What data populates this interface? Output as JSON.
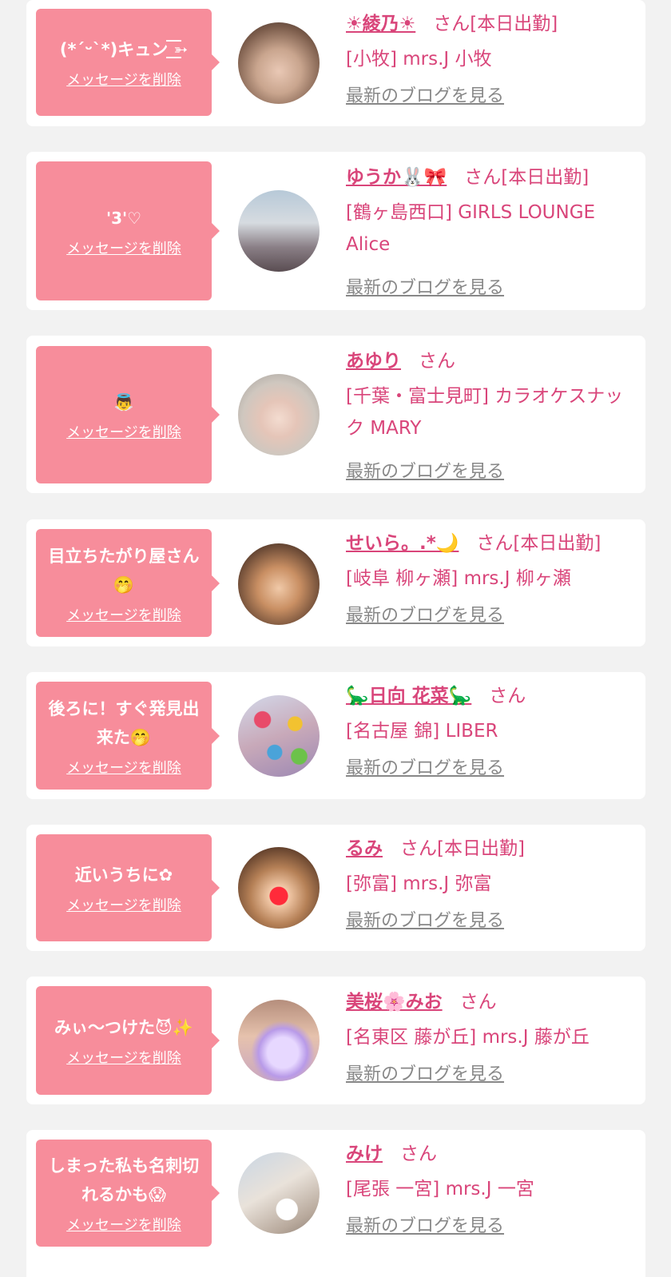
{
  "items": [
    {
      "message": "(*ˊᵕˋ*)キュン ͟͟͞͞➳",
      "delete_label": "メッセージを削除",
      "name": "☀綾乃☀",
      "san": "さん[本日出勤]",
      "shop": "[小牧] mrs.J 小牧",
      "blog_label": "最新のブログを見る"
    },
    {
      "message": "'3'♡",
      "delete_label": "メッセージを削除",
      "name": "ゆうか🐰🎀",
      "san": "さん[本日出勤]",
      "shop": "[鶴ヶ島西口] GIRLS LOUNGE Alice",
      "blog_label": "最新のブログを見る"
    },
    {
      "message": "👼",
      "delete_label": "メッセージを削除",
      "name": "あゆり",
      "san": "さん",
      "shop": "[千葉・富士見町] カラオケスナック MARY",
      "blog_label": "最新のブログを見る"
    },
    {
      "message": "目立ちたがり屋さん🤭",
      "delete_label": "メッセージを削除",
      "name": "せいら。.*🌙",
      "san": "さん[本日出勤]",
      "shop": "[岐阜 柳ヶ瀬] mrs.J 柳ヶ瀬",
      "blog_label": "最新のブログを見る"
    },
    {
      "message": "後ろに！すぐ発見出来た🤭",
      "delete_label": "メッセージを削除",
      "name": "🦕日向 花菜🦕",
      "san": "さん",
      "shop": "[名古屋 錦] LIBER",
      "blog_label": "最新のブログを見る"
    },
    {
      "message": "近いうちに✿",
      "delete_label": "メッセージを削除",
      "name": "るみ",
      "san": "さん[本日出勤]",
      "shop": "[弥富] mrs.J 弥富",
      "blog_label": "最新のブログを見る"
    },
    {
      "message": "みぃ〜つけた😈✨",
      "delete_label": "メッセージを削除",
      "name": "美桜🌸みお",
      "san": "さん",
      "shop": "[名東区 藤が丘] mrs.J 藤が丘",
      "blog_label": "最新のブログを見る"
    },
    {
      "message": "しまった私も名刺切れるかも😱",
      "delete_label": "メッセージを削除",
      "name": "みけ",
      "san": "さん",
      "shop": "[尾張 一宮] mrs.J 一宮",
      "blog_label": "最新のブログを見る"
    }
  ],
  "colors": {
    "bubble": "#f78d9b",
    "name": "#d9457a",
    "link": "#888888",
    "background": "#f2f2f2"
  }
}
